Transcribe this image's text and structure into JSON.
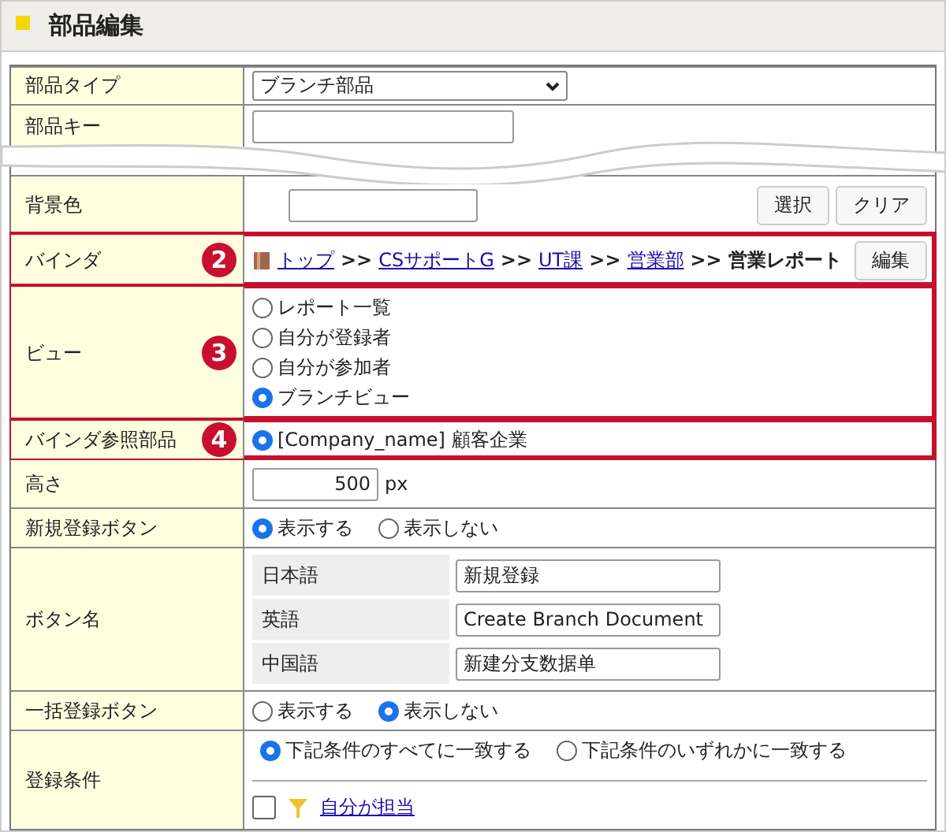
{
  "header": {
    "title": "部品編集"
  },
  "rows": [
    {
      "kind": "select",
      "label": "部品タイプ",
      "value": "ブランチ部品"
    },
    {
      "kind": "text",
      "label": "部品キー"
    },
    {
      "kind": "tear"
    },
    {
      "kind": "color",
      "label": "背景色",
      "buttons": [
        "選択",
        "クリア"
      ]
    },
    {
      "kind": "breadcrumb",
      "label": "バインダ",
      "callout": "2",
      "crumbs": [
        {
          "text": "トップ",
          "link": true
        },
        {
          "text": ">>",
          "link": false
        },
        {
          "text": "CSサポートG",
          "link": true
        },
        {
          "text": ">>",
          "link": false
        },
        {
          "text": "UT課",
          "link": true
        },
        {
          "text": ">>",
          "link": false
        },
        {
          "text": "営業部",
          "link": true
        },
        {
          "text": ">>",
          "link": false
        },
        {
          "text": "営業レポート",
          "link": false
        }
      ],
      "button": "編集"
    },
    {
      "kind": "radios",
      "label": "ビュー",
      "callout": "3",
      "vertical": true,
      "options": [
        {
          "text": "レポート一覧",
          "selected": false
        },
        {
          "text": "自分が登録者",
          "selected": false
        },
        {
          "text": "自分が参加者",
          "selected": false
        },
        {
          "text": "ブランチビュー",
          "selected": true
        }
      ]
    },
    {
      "kind": "radios",
      "label": "バインダ参照部品",
      "callout": "4",
      "vertical": false,
      "options": [
        {
          "text": "[Company_name] 顧客企業",
          "selected": true
        }
      ]
    },
    {
      "kind": "number",
      "label": "高さ",
      "value": "500",
      "unit": "px"
    },
    {
      "kind": "radios",
      "label": "新規登録ボタン",
      "vertical": false,
      "options": [
        {
          "text": "表示する",
          "selected": true
        },
        {
          "text": "表示しない",
          "selected": false
        }
      ]
    },
    {
      "kind": "names",
      "label": "ボタン名",
      "names": [
        {
          "lang": "日本語",
          "value": "新規登録"
        },
        {
          "lang": "英語",
          "value": "Create Branch Document"
        },
        {
          "lang": "中国語",
          "value": "新建分支数据单"
        }
      ]
    },
    {
      "kind": "radios",
      "label": "一括登録ボタン",
      "vertical": false,
      "options": [
        {
          "text": "表示する",
          "selected": false
        },
        {
          "text": "表示しない",
          "selected": true
        }
      ]
    },
    {
      "kind": "conditions",
      "label": "登録条件",
      "options": [
        {
          "text": "下記条件のすべてに一致する",
          "selected": true
        },
        {
          "text": "下記条件のいずれかに一致する",
          "selected": false
        }
      ],
      "filter": {
        "checked": false,
        "text": "自分が担当"
      }
    }
  ]
}
